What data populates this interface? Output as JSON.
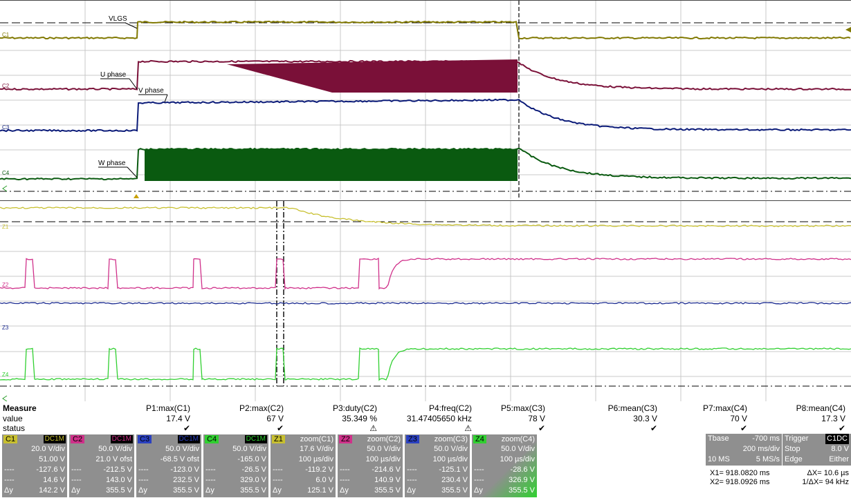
{
  "top_traces": {
    "labels": {
      "vlgs": "VLGS",
      "uphase": "U phase",
      "vphase": "V phase",
      "wphase": "W phase"
    },
    "channels": [
      "C1",
      "C2",
      "C3",
      "C4"
    ]
  },
  "zoom_traces": {
    "channels": [
      "Z1",
      "Z2",
      "Z3",
      "Z4"
    ]
  },
  "colors": {
    "c1": "#807800",
    "c2": "#7a1038",
    "c3": "#0a1a78",
    "c4": "#0a5a10",
    "z1": "#c8c030",
    "z2": "#d0308a",
    "z3": "#1a2a90",
    "z4": "#30d030"
  },
  "measure": {
    "title": "Measure",
    "row_value": "value",
    "row_status": "status",
    "params": [
      {
        "name": "P1:max(C1)",
        "value": "17.4 V",
        "status": "✔"
      },
      {
        "name": "P2:max(C2)",
        "value": "67 V",
        "status": "✔"
      },
      {
        "name": "P3:duty(C2)",
        "value": "35.349 %",
        "status": "⚠"
      },
      {
        "name": "P4:freq(C2)",
        "value": "31.47405650 kHz",
        "status": "⚠"
      },
      {
        "name": "P5:max(C3)",
        "value": "78 V",
        "status": "✔"
      },
      {
        "name": "P6:mean(C3)",
        "value": "30.3 V",
        "status": "✔"
      },
      {
        "name": "P7:max(C4)",
        "value": "70 V",
        "status": "✔"
      },
      {
        "name": "P8:mean(C4)",
        "value": "17.3 V",
        "status": "✔"
      }
    ]
  },
  "channel_boxes": [
    {
      "tag": "C1",
      "coupling": "DC1M",
      "tagcolor": "#c8c030",
      "lines": [
        "20.0 V/div",
        "51.00 V",
        "-127.6 V",
        "14.6 V",
        "142.2 V"
      ]
    },
    {
      "tag": "C2",
      "coupling": "DC1M",
      "tagcolor": "#d0308a",
      "lines": [
        "50.0 V/div",
        "21.0 V ofst",
        "-212.5 V",
        "143.0 V",
        "355.5 V"
      ]
    },
    {
      "tag": "C3",
      "coupling": "DC1M",
      "tagcolor": "#2a40c0",
      "lines": [
        "50.0 V/div",
        "-68.5 V ofst",
        "-123.0 V",
        "232.5 V",
        "355.5 V"
      ]
    },
    {
      "tag": "C4",
      "coupling": "DC1M",
      "tagcolor": "#30d030",
      "lines": [
        "50.0 V/div",
        "-165.0 V",
        "-26.5 V",
        "329.0 V",
        "355.5 V"
      ]
    },
    {
      "tag": "Z1",
      "coupling": "zoom(C1)",
      "tagcolor": "#c8c030",
      "lines": [
        "17.6 V/div",
        "100 µs/div",
        "-119.2 V",
        "6.0 V",
        "125.1 V"
      ]
    },
    {
      "tag": "Z2",
      "coupling": "zoom(C2)",
      "tagcolor": "#d0308a",
      "lines": [
        "50.0 V/div",
        "100 µs/div",
        "-214.6 V",
        "140.9 V",
        "355.5 V"
      ]
    },
    {
      "tag": "Z3",
      "coupling": "zoom(C3)",
      "tagcolor": "#2a40c0",
      "lines": [
        "50.0 V/div",
        "100 µs/div",
        "-125.1 V",
        "230.4 V",
        "355.5 V"
      ]
    },
    {
      "tag": "Z4",
      "coupling": "zoom(C4)",
      "tagcolor": "#30d030",
      "lines": [
        "50.0 V/div",
        "100 µs/div",
        "-28.6 V",
        "326.9 V",
        "355.5 V"
      ]
    }
  ],
  "timebase": {
    "label": "Tbase",
    "delay": "-700 ms",
    "scale": "200 ms/div",
    "samples": "10 MS",
    "rate": "5 MS/s"
  },
  "trigger": {
    "label": "Trigger",
    "source": "C1",
    "coupling": "DC",
    "mode": "Stop",
    "level": "8.0 V",
    "type": "Edge",
    "slope": "Either"
  },
  "cursors": {
    "x1": "X1=  918.0820 ms",
    "x2": "X2=  918.0926 ms",
    "dx": "ΔX=  10.6 µs",
    "inv_dx": "1/ΔX=  94 kHz"
  }
}
